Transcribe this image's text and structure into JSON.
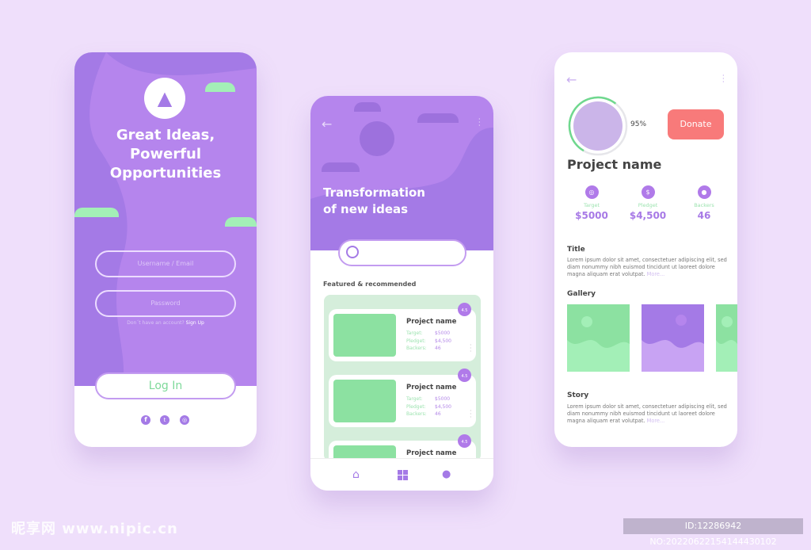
{
  "login": {
    "title_lines": [
      "Great Ideas,",
      "Powerful",
      "Opportunities"
    ],
    "username_placeholder": "Username / Email",
    "password_placeholder": "Password",
    "signup_prompt": "Don´t have  an account?",
    "signup_link": "Sign Up",
    "login_button": "Log In",
    "social": [
      "facebook-icon",
      "twitter-icon",
      "instagram-icon"
    ],
    "logo": "rocket-icon"
  },
  "explore": {
    "title_lines": [
      "Transformation",
      "of new ideas"
    ],
    "search_placeholder": "",
    "section": "Featured & recommended",
    "cards": [
      {
        "name": "Project name",
        "rating": "4.5",
        "target_label": "Target:",
        "target": "$5000",
        "pledged_label": "Pledget:",
        "pledged": "$4,500",
        "backers_label": "Backers:",
        "backers": "46"
      },
      {
        "name": "Project name",
        "rating": "4.5",
        "target_label": "Target:",
        "target": "$5000",
        "pledged_label": "Pledget:",
        "pledged": "$4,500",
        "backers_label": "Backers:",
        "backers": "46"
      },
      {
        "name": "Project name",
        "rating": "4.5"
      }
    ],
    "nav": [
      "home-icon",
      "grid-icon",
      "user-icon"
    ]
  },
  "detail": {
    "progress_percent": 95,
    "progress_label": "95%",
    "donate": "Donate",
    "project_name": "Project name",
    "stats": [
      {
        "label": "Target",
        "value": "$5000",
        "icon": "target-icon"
      },
      {
        "label": "Pledget",
        "value": "$4,500",
        "icon": "dollar-icon"
      },
      {
        "label": "Backers",
        "value": "46",
        "icon": "user-icon"
      }
    ],
    "title_heading": "Title",
    "title_text": "Lorem ipsum dolor sit amet, consectetuer adipiscing elit, sed diam nonummy nibh euismod tincidunt ut laoreet dolore magna aliquam erat volutpat.",
    "more": "More...",
    "gallery_heading": "Gallery",
    "story_heading": "Story",
    "story_text": "Lorem ipsum dolor sit amet, consectetuer adipiscing elit, sed diam nonummy nibh euismod tincidunt ut laoreet dolore magna aliquam erat volutpat."
  },
  "watermark": {
    "logo_text": "昵享网 www.nipic.cn",
    "id_text": "ID:12286942 NO:20220622154144430102"
  },
  "colors": {
    "purple": "#a47ae6",
    "green": "#8ce1a1",
    "donate": "#f87a7a",
    "background": "#efdffb"
  }
}
